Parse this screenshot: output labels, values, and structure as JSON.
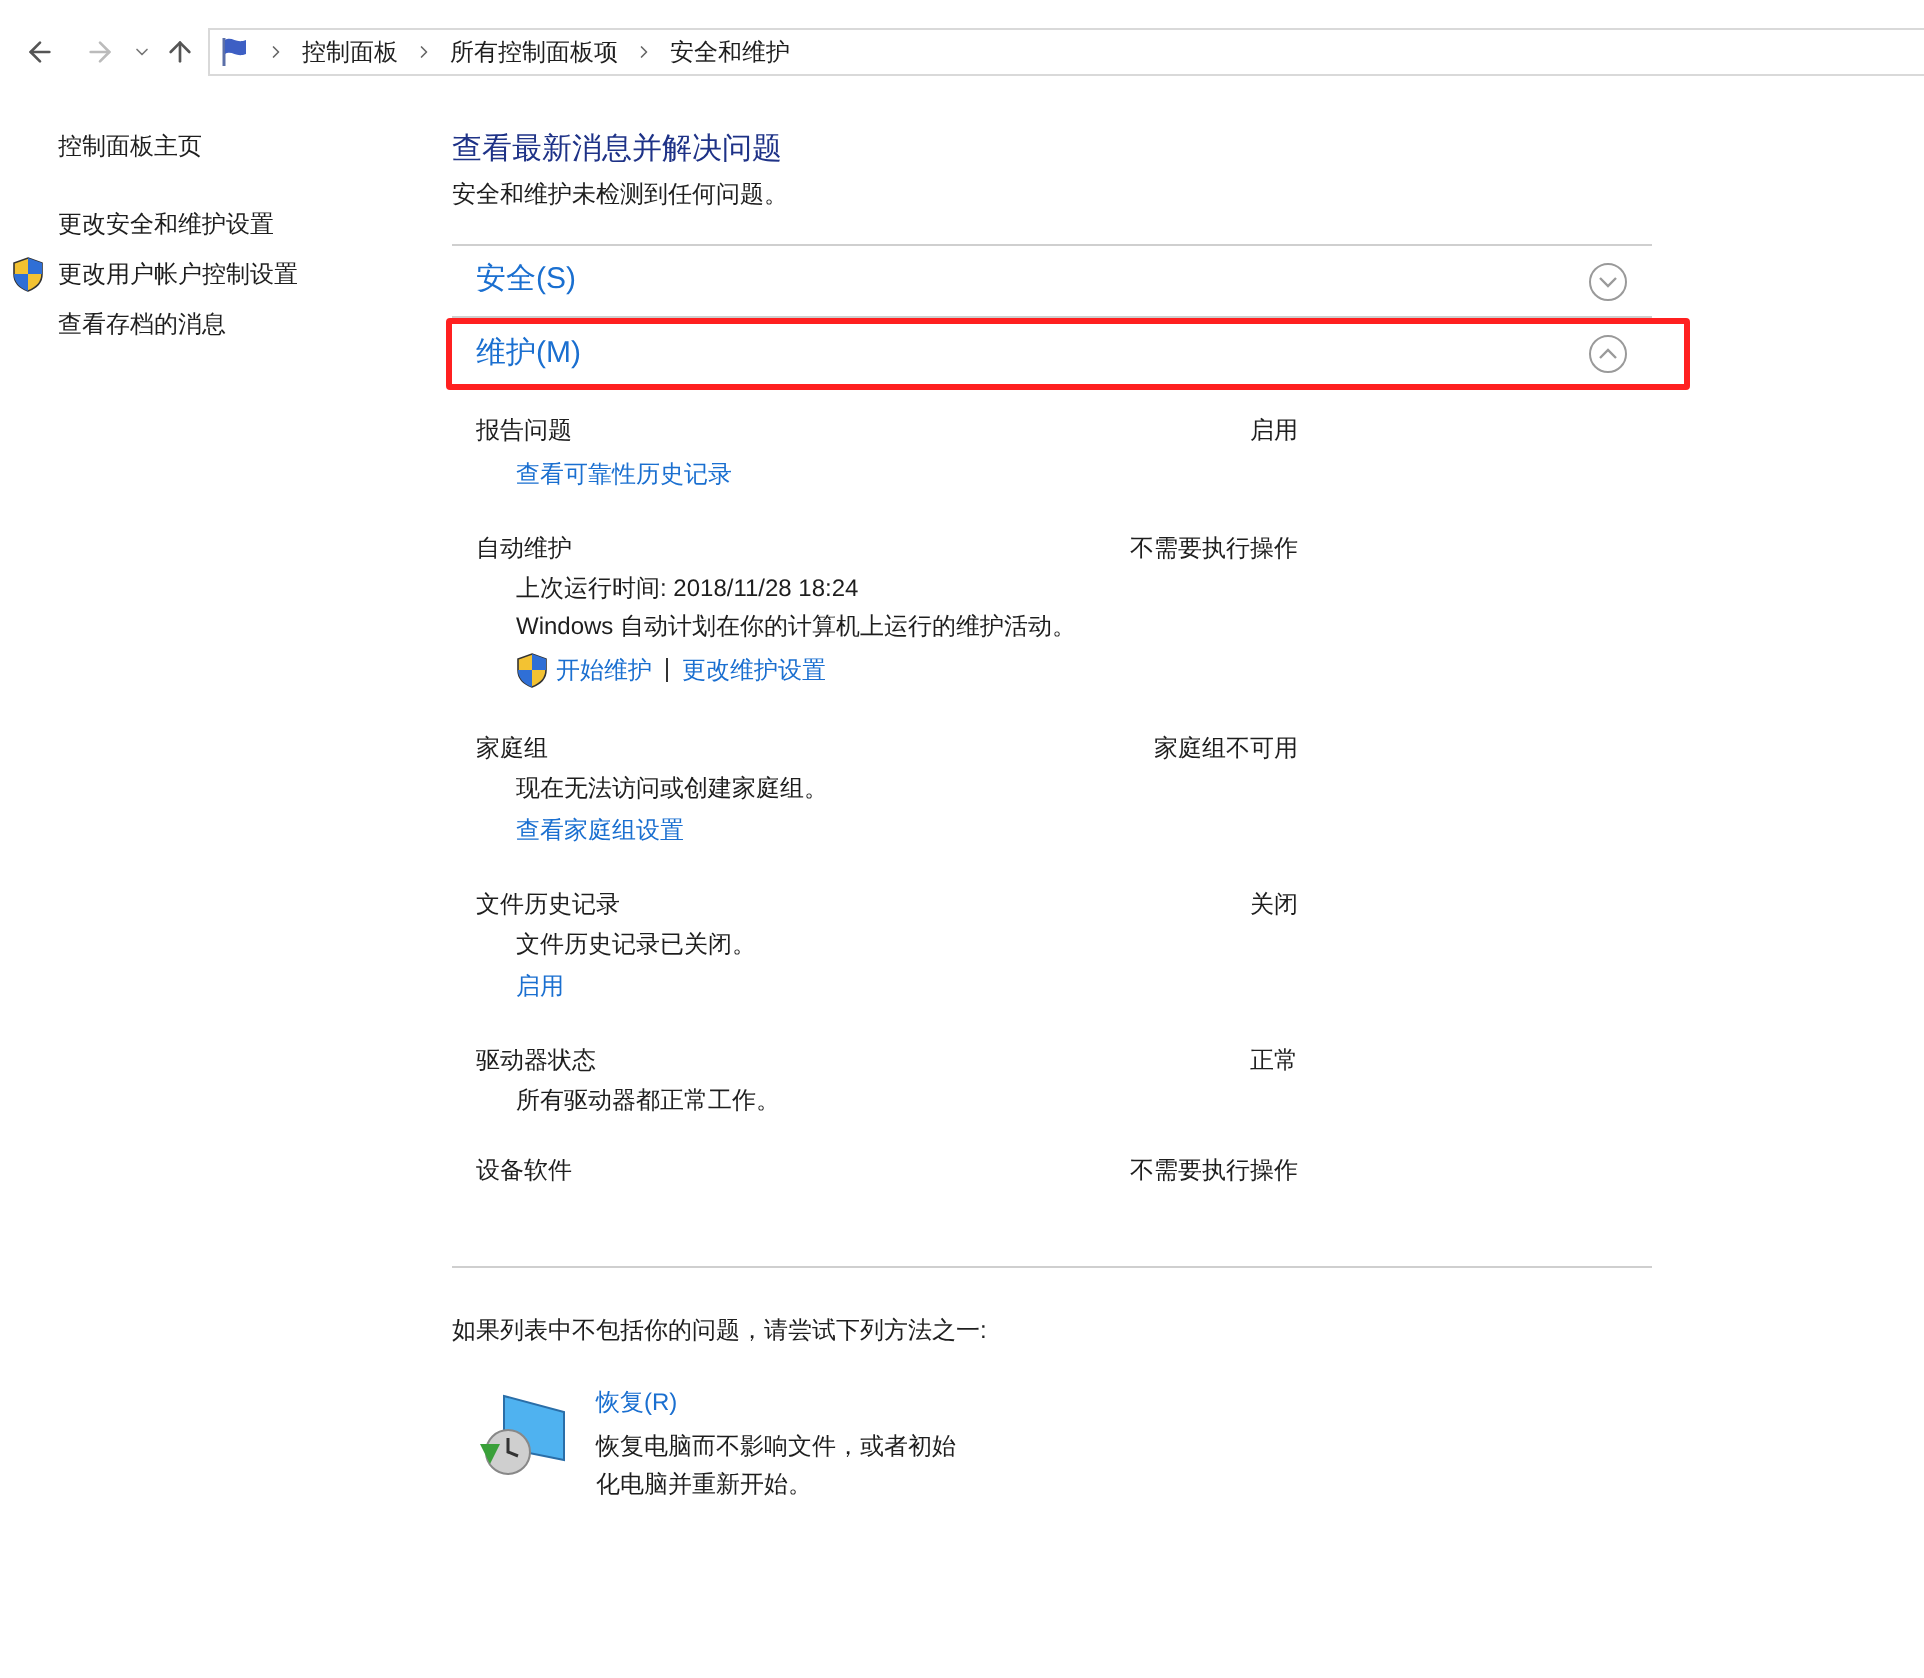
{
  "breadcrumb": [
    "控制面板",
    "所有控制面板项",
    "安全和维护"
  ],
  "sidebar": {
    "items": [
      {
        "label": "控制面板主页",
        "shield": false
      },
      {
        "label": "更改安全和维护设置",
        "shield": false
      },
      {
        "label": "更改用户帐户控制设置",
        "shield": true
      },
      {
        "label": "查看存档的消息",
        "shield": false
      }
    ]
  },
  "heading": "查看最新消息并解决问题",
  "summary": "安全和维护未检测到任何问题。",
  "sections": [
    {
      "title": "安全(S)",
      "expanded": false,
      "highlighted": false
    },
    {
      "title": "维护(M)",
      "expanded": true,
      "highlighted": true,
      "items": [
        {
          "name": "报告问题",
          "status": "启用",
          "lines": [
            {
              "kind": "link",
              "text": "查看可靠性历史记录"
            }
          ]
        },
        {
          "name": "自动维护",
          "status": "不需要执行操作",
          "lines": [
            {
              "kind": "text",
              "text": "上次运行时间: 2018/11/28 18:24"
            },
            {
              "kind": "text",
              "text": "Windows 自动计划在你的计算机上运行的维护活动。"
            },
            {
              "kind": "actions",
              "links": [
                "开始维护",
                "更改维护设置"
              ]
            }
          ]
        },
        {
          "name": "家庭组",
          "status": "家庭组不可用",
          "lines": [
            {
              "kind": "text",
              "text": "现在无法访问或创建家庭组。"
            },
            {
              "kind": "link",
              "text": "查看家庭组设置"
            }
          ]
        },
        {
          "name": "文件历史记录",
          "status": "关闭",
          "lines": [
            {
              "kind": "text",
              "text": "文件历史记录已关闭。"
            },
            {
              "kind": "link",
              "text": "启用"
            }
          ]
        },
        {
          "name": "驱动器状态",
          "status": "正常",
          "lines": [
            {
              "kind": "text",
              "text": "所有驱动器都正常工作。"
            }
          ]
        },
        {
          "name": "设备软件",
          "status": "不需要执行操作"
        }
      ]
    }
  ],
  "footer": {
    "prompt": "如果列表中不包括你的问题，请尝试下列方法之一:",
    "recovery": {
      "title": "恢复(R)",
      "description": "恢复电脑而不影响文件，或者初始化电脑并重新开始。"
    }
  }
}
